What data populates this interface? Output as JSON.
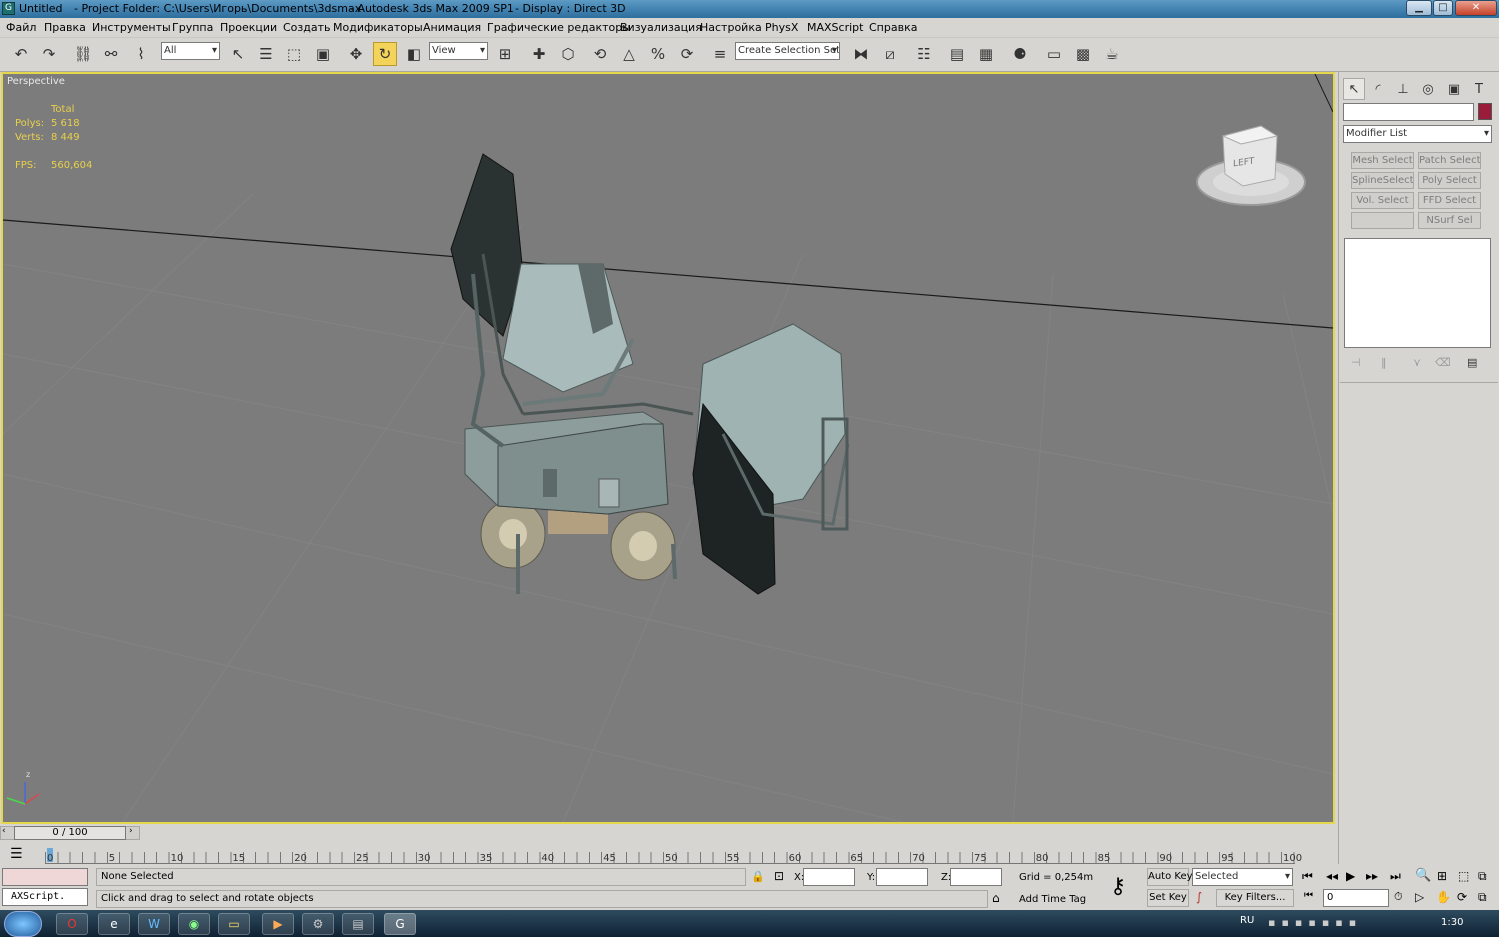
{
  "titlebar": {
    "doc": "Untitled",
    "project": "- Project Folder: C:\\Users\\Игорь\\Documents\\3dsmax",
    "app": "- Autodesk 3ds Max  2009 SP1",
    "display": "- Display : Direct 3D",
    "min": "▁",
    "max": "□",
    "close": "✕"
  },
  "menu": [
    "Файл",
    "Правка",
    "Инструменты",
    "Группа",
    "Проекции",
    "Создать",
    "Модификаторы",
    "Анимация",
    "Графические редакторы",
    "Визуализация",
    "Настройка",
    "PhysX",
    "MAXScript",
    "Справка"
  ],
  "toolbar": {
    "filter": "All",
    "coord": "View",
    "selection_set": "Create Selection Set"
  },
  "viewport": {
    "label": "Perspective",
    "stats": {
      "total_label": "Total",
      "polys_label": "Polys:",
      "polys_value": "5 618",
      "verts_label": "Verts:",
      "verts_value": "8 449",
      "fps_label": "FPS:",
      "fps_value": "560,604"
    },
    "viewcube": "LEFT",
    "axis_z": "z"
  },
  "command_panel": {
    "modifier_list": "Modifier List",
    "buttons": [
      "Mesh Select",
      "Patch Select",
      "SplineSelect",
      "Poly Select",
      "Vol. Select",
      "FFD Select",
      "",
      "NSurf Sel"
    ],
    "accent": "#9b1b3a"
  },
  "timeline": {
    "slider": "0 / 100",
    "ticks": [
      "0",
      "5",
      "10",
      "15",
      "20",
      "25",
      "30",
      "35",
      "40",
      "45",
      "50",
      "55",
      "60",
      "65",
      "70",
      "75",
      "80",
      "85",
      "90",
      "95",
      "100"
    ]
  },
  "status": {
    "maxscript": "AXScript.",
    "selected": "None Selected",
    "prompt": "Click and drag to select and rotate objects",
    "x": "X:",
    "y": "Y:",
    "z": "Z:",
    "grid": "Grid = 0,254m",
    "add_time_tag": "Add Time Tag",
    "auto_key": "Auto Key",
    "set_key": "Set Key",
    "key_mode": "Selected",
    "key_filters": "Key Filters...",
    "frame": "0"
  },
  "taskbar": {
    "lang": "RU",
    "time": "1:30"
  }
}
